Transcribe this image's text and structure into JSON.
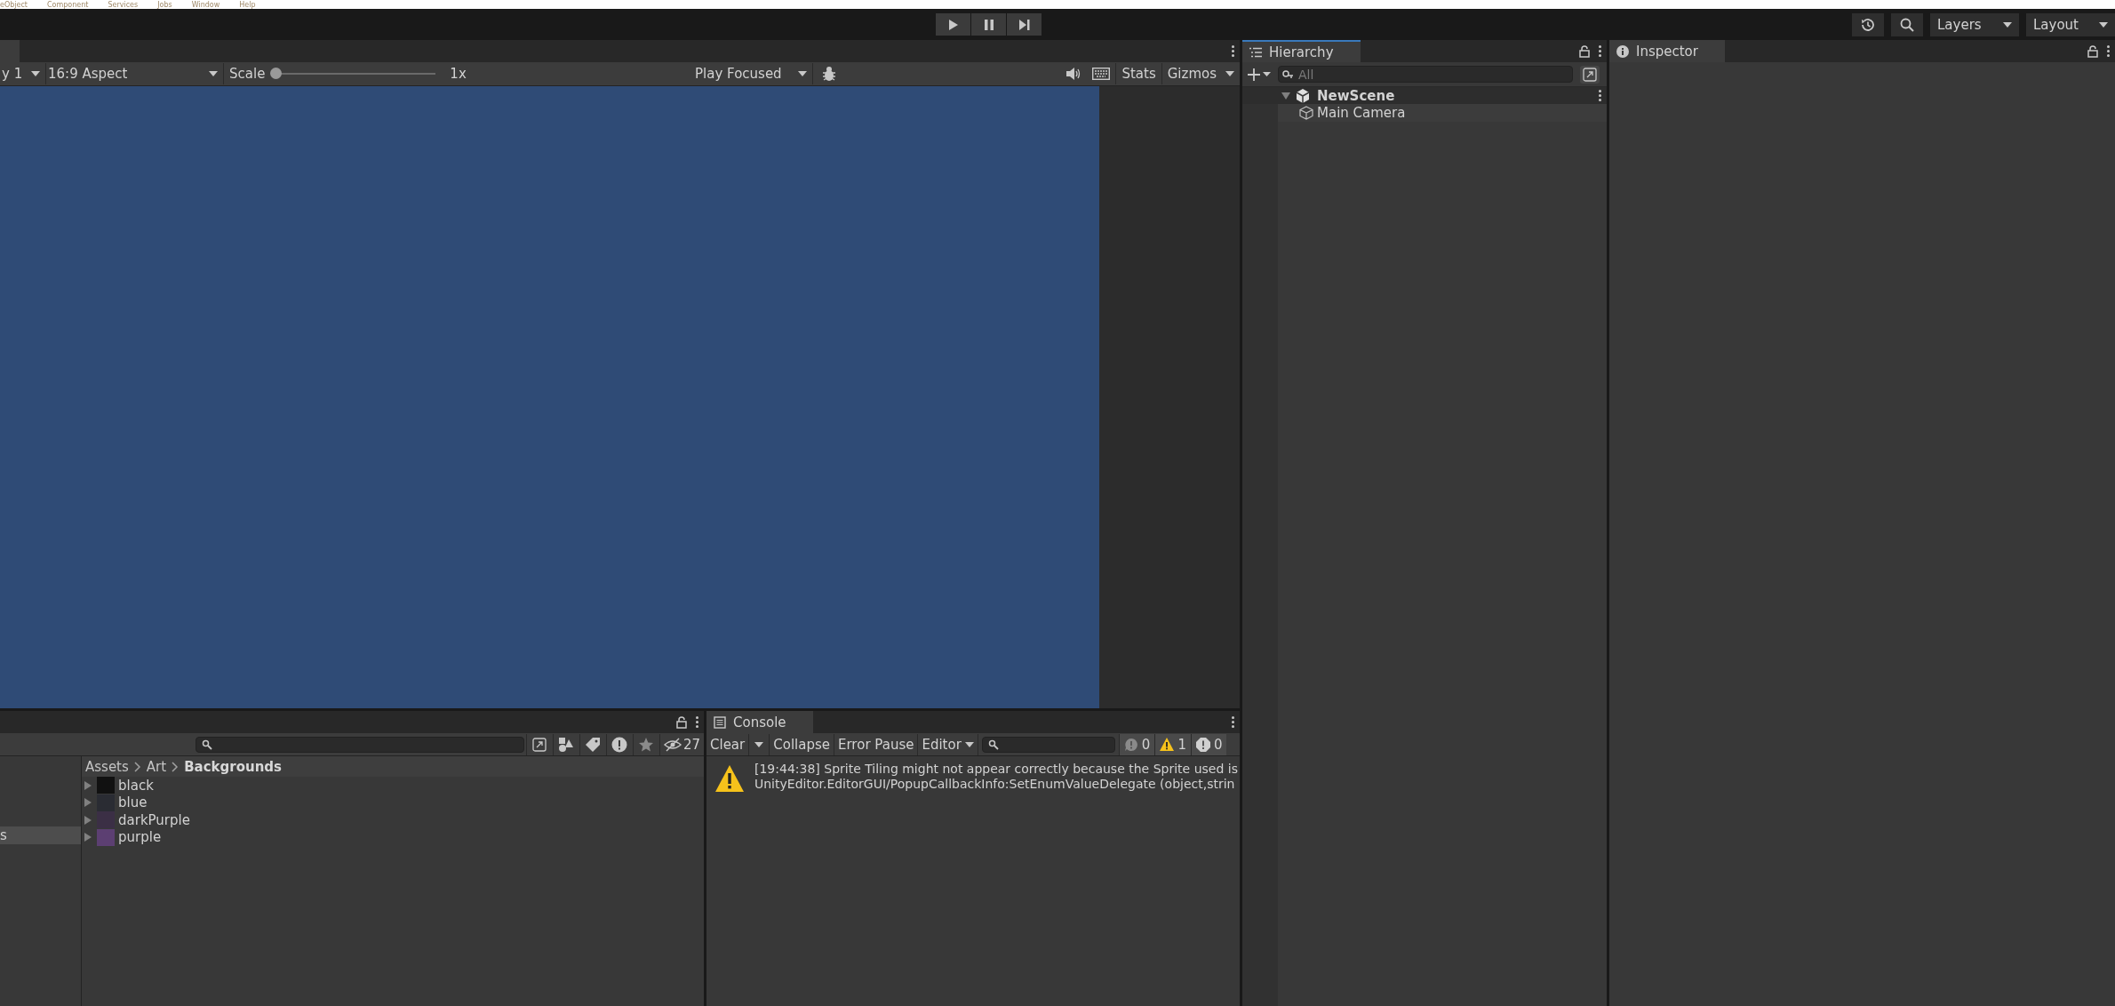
{
  "menu_bar": {
    "items": [
      "eObject",
      "Component",
      "Services",
      "Jobs",
      "Window",
      "Help"
    ]
  },
  "toolbar": {
    "controls": [
      {
        "kind": "play"
      },
      {
        "kind": "pause"
      },
      {
        "kind": "step"
      }
    ],
    "dropdowns": [
      "Layers",
      "Layout"
    ]
  },
  "game_view": {
    "display": "y 1",
    "aspect": "16:9 Aspect",
    "scale_label": "Scale",
    "scale": {
      "level": 0
    },
    "scale_value": "1x",
    "play_mode": "Play Focused",
    "stats": "Stats",
    "gizmos": "Gizmos"
  },
  "hierarchy": {
    "title": "Hierarchy",
    "search": {
      "placeholder": "All"
    },
    "items": [
      {
        "label": "NewScene",
        "kind": "scene",
        "expanded": true,
        "children": [
          {
            "label": "Main Camera",
            "kind": "object"
          }
        ]
      }
    ]
  },
  "inspector": {
    "title": "Inspector"
  },
  "project": {
    "hidden_count": "27",
    "tree": [
      {
        "label": "s",
        "selected": true
      }
    ],
    "breadcrumb": [
      "Assets",
      "Art",
      "Backgrounds"
    ],
    "items": [
      {
        "name": "black",
        "color": "#111111"
      },
      {
        "name": "blue",
        "color": "#2a2c33"
      },
      {
        "name": "darkPurple",
        "color": "#3b2f45"
      },
      {
        "name": "purple",
        "color": "#5c3f72"
      }
    ]
  },
  "console": {
    "title": "Console",
    "buttons": [
      "Clear",
      "Collapse",
      "Error Pause"
    ],
    "source": "Editor",
    "counts": [
      {
        "kind": "info",
        "count": "0"
      },
      {
        "kind": "warning",
        "count": "1"
      },
      {
        "kind": "error",
        "count": "0"
      }
    ],
    "messages": [
      {
        "kind": "warning",
        "lines": [
          "[19:44:38] Sprite Tiling might not appear correctly because the Sprite used is",
          "UnityEditor.EditorGUI/PopupCallbackInfo:SetEnumValueDelegate (object,strin"
        ]
      }
    ]
  }
}
